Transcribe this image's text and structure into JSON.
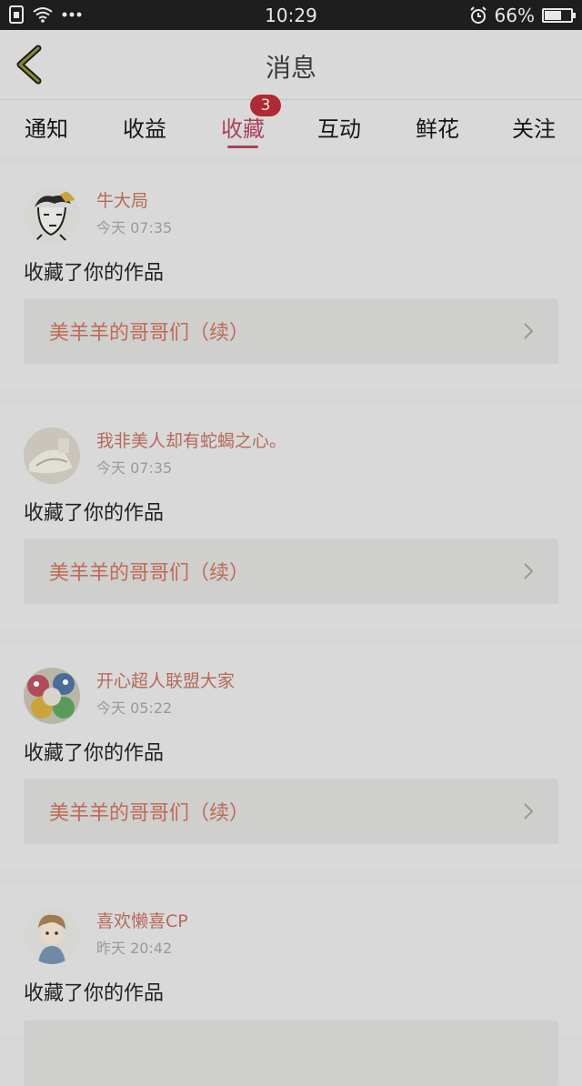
{
  "status_bar": {
    "time": "10:29",
    "battery": "66%",
    "battery_level": 0.66,
    "icons": [
      "sim-icon",
      "wifi-icon",
      "more-dots-icon",
      "alarm-icon",
      "battery-icon"
    ]
  },
  "header": {
    "title": "消息",
    "back_icon": "chevron-left-icon"
  },
  "tabs": [
    {
      "label": "通知"
    },
    {
      "label": "收益"
    },
    {
      "label": "收藏",
      "badge": "3",
      "active": true
    },
    {
      "label": "互动"
    },
    {
      "label": "鲜花"
    },
    {
      "label": "关注"
    }
  ],
  "messages": [
    {
      "name": "牛大局",
      "time": "今天 07:35",
      "action": "收藏了你的作品",
      "work": "美羊羊的哥哥们（续）"
    },
    {
      "name": "我非美人却有蛇蝎之心。",
      "time": "今天 07:35",
      "action": "收藏了你的作品",
      "work": "美羊羊的哥哥们（续）"
    },
    {
      "name": "开心超人联盟大家",
      "time": "今天 05:22",
      "action": "收藏了你的作品",
      "work": "美羊羊的哥哥们（续）"
    },
    {
      "name": "喜欢懒喜CP",
      "time": "昨天 20:42",
      "action": "收藏了你的作品",
      "work": ""
    }
  ],
  "colors": {
    "accent": "#a8435a",
    "badge": "#b02a35",
    "username": "#b56a57",
    "work_title": "#bf6a55"
  }
}
